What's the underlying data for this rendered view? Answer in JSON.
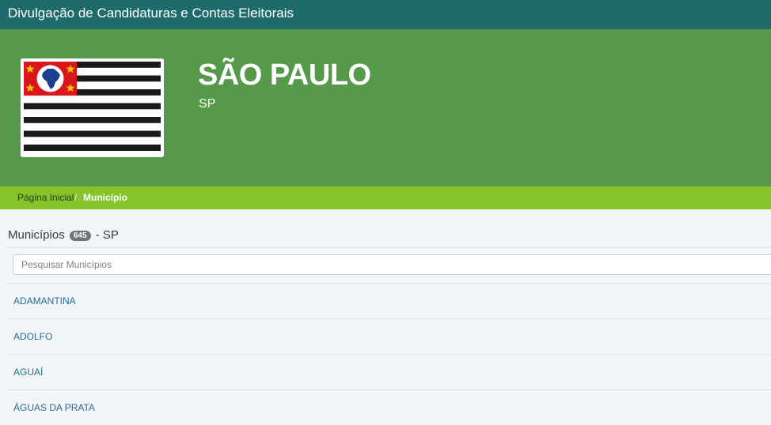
{
  "app": {
    "title": "Divulgação de Candidaturas e Contas Eleitorais"
  },
  "state": {
    "name": "SÃO PAULO",
    "uf": "SP",
    "flag_icon": "sao-paulo-flag"
  },
  "breadcrumb": {
    "home_label": "Página Inicial",
    "separator": "/",
    "current_label": "Município"
  },
  "municipalities": {
    "heading_label": "Municípios",
    "count": "645",
    "heading_suffix": "- SP",
    "search_placeholder": "Pesquisar Municípios",
    "items": [
      {
        "name": "ADAMANTINA"
      },
      {
        "name": "ADOLFO"
      },
      {
        "name": "AGUAÍ"
      },
      {
        "name": "ÁGUAS DA PRATA"
      }
    ]
  },
  "colors": {
    "topbar": "#1f6b6b",
    "hero": "#56994a",
    "breadcrumb_bar": "#86c42a",
    "link": "#2b6b8f",
    "flag_red": "#d9161c",
    "flag_blue": "#1c3f8f",
    "flag_star": "#f7c600",
    "flag_black": "#1a1a1a"
  }
}
